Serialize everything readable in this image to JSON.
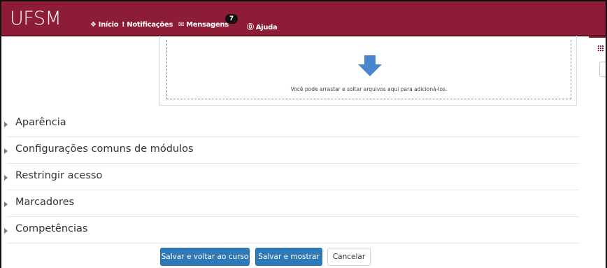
{
  "navbar": {
    "brand": "UFSM",
    "items": [
      {
        "icon": "home-icon",
        "glyph": "❖",
        "label": "Início"
      },
      {
        "icon": "alert-icon",
        "glyph": "!",
        "label": "Notificações"
      },
      {
        "icon": "envelope-icon",
        "glyph": "✉",
        "label": "Mensagens"
      },
      {
        "icon": "help-icon",
        "glyph": "⓪",
        "label": "Ajuda"
      }
    ],
    "messages_badge": "7",
    "background_color": "#8d1c36"
  },
  "dropzone": {
    "text": "Você pode arrastar e soltar arquivos aqui para adicioná-los.",
    "arrow_color": "#4a86cf"
  },
  "sections": [
    {
      "label": "Aparência"
    },
    {
      "label": "Configurações comuns de módulos"
    },
    {
      "label": "Restringir acesso"
    },
    {
      "label": "Marcadores"
    },
    {
      "label": "Competências"
    }
  ],
  "actions": {
    "save_return": "Salvar e voltar ao curso",
    "save_show": "Salvar e mostrar",
    "cancel": "Cancelar",
    "primary_color": "#2f79b8"
  }
}
